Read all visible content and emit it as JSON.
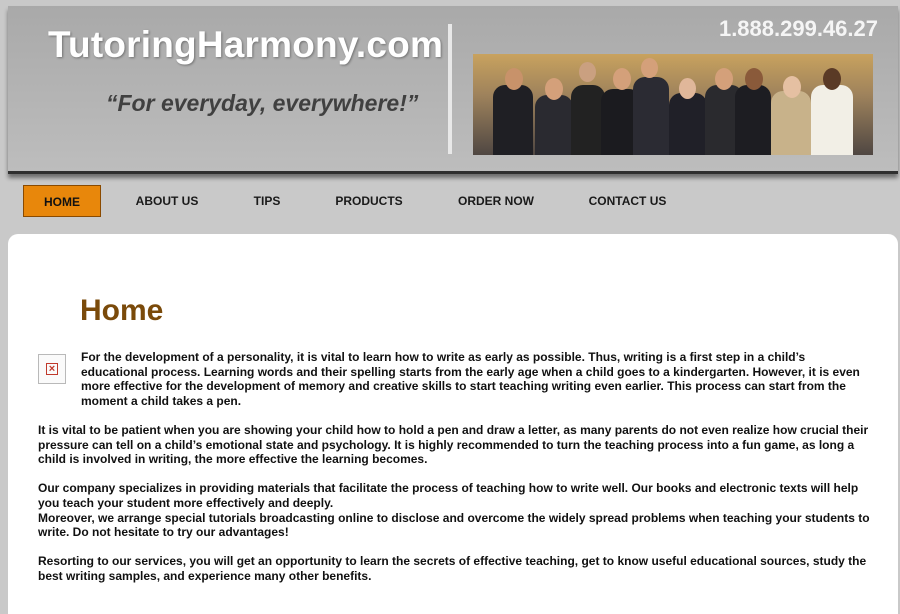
{
  "header": {
    "site_name": "TutoringHarmony.com",
    "tagline": "“For everyday, everywhere!”",
    "phone": "1.888.299.46.27"
  },
  "nav": {
    "items": [
      {
        "label": "HOME",
        "active": true
      },
      {
        "label": "ABOUT US",
        "active": false
      },
      {
        "label": "TIPS",
        "active": false
      },
      {
        "label": "PRODUCTS",
        "active": false
      },
      {
        "label": "ORDER NOW",
        "active": false
      },
      {
        "label": "CONTACT US",
        "active": false
      }
    ]
  },
  "main": {
    "title": "Home",
    "paragraphs": [
      "For the development of a personality, it is vital to learn how to write as early as possible. Thus, writing is a first step in a child’s educational process. Learning words and their spelling starts from the early age when a child goes to a kindergarten. However, it is even more effective for the development of memory and creative skills to start teaching writing even earlier. This process can start from the moment a child takes a pen.",
      "It is vital to be patient when you are showing your child how to hold a pen and draw a letter, as many parents do not even realize how crucial their pressure can tell on a child’s emotional state and psychology. It is highly recommended to turn the teaching process into a fun game, as long a child is involved in writing, the more effective the learning becomes.",
      "Our company specializes in providing materials that facilitate the process of teaching how to write well. Our books and electronic texts will help you teach your student more effectively and deeply.",
      "Moreover, we arrange special tutorials broadcasting online to disclose and overcome the widely spread problems when teaching your students to write. Do not hesitate to try our advantages!",
      "Resorting to our services, you will get an opportunity to learn the secrets of effective teaching, get to know useful educational sources, study the best writing samples, and experience many other benefits."
    ]
  },
  "colors": {
    "accent": "#e8870b",
    "title": "#7a4a0a",
    "background": "#c9c9c9"
  },
  "icons": {
    "broken_image": "broken-image-icon"
  }
}
